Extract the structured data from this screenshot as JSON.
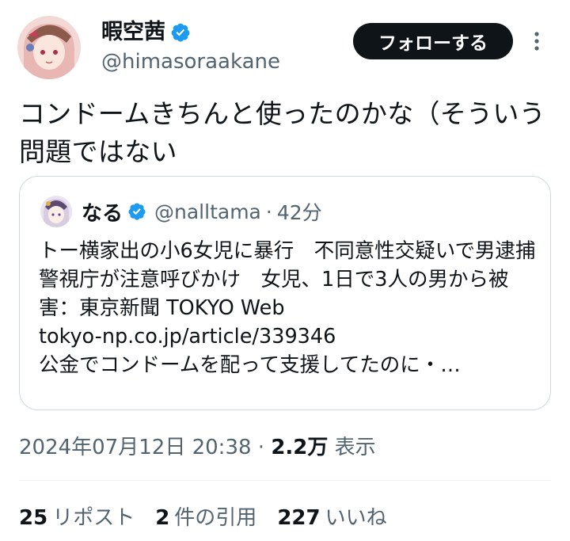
{
  "author": {
    "display_name": "暇空茜",
    "handle": "@himasoraakane"
  },
  "follow_button": {
    "label": "フォローする"
  },
  "tweet": {
    "text": "コンドームきちんと使ったのかな（そういう問題ではない"
  },
  "quote": {
    "name": "なる",
    "handle": "@nalltama",
    "separator": "·",
    "time": "42分",
    "body": "トー横家出の小6女児に暴行　不同意性交疑いで男逮捕　警視庁が注意呼びかけ　女児、1日で3人の男から被害：東京新聞 TOKYO Web\ntokyo-np.co.jp/article/339346\n公金でコンドームを配って支援してたのに・…"
  },
  "meta": {
    "timestamp": "2024年07月12日 20:38",
    "separator": "·",
    "views_count": "2.2万",
    "views_label": "表示"
  },
  "stats": {
    "reposts_count": "25",
    "reposts_label": "リポスト",
    "quotes_count": "2",
    "quotes_label": "件の引用",
    "likes_count": "227",
    "likes_label": "いいね"
  },
  "colors": {
    "verified": "#1d9bf0",
    "text_primary": "#0f1419",
    "text_secondary": "#536471",
    "border": "#cfd9de"
  },
  "icons": {
    "verified": "verified-badge-icon",
    "more": "more-options-icon"
  }
}
